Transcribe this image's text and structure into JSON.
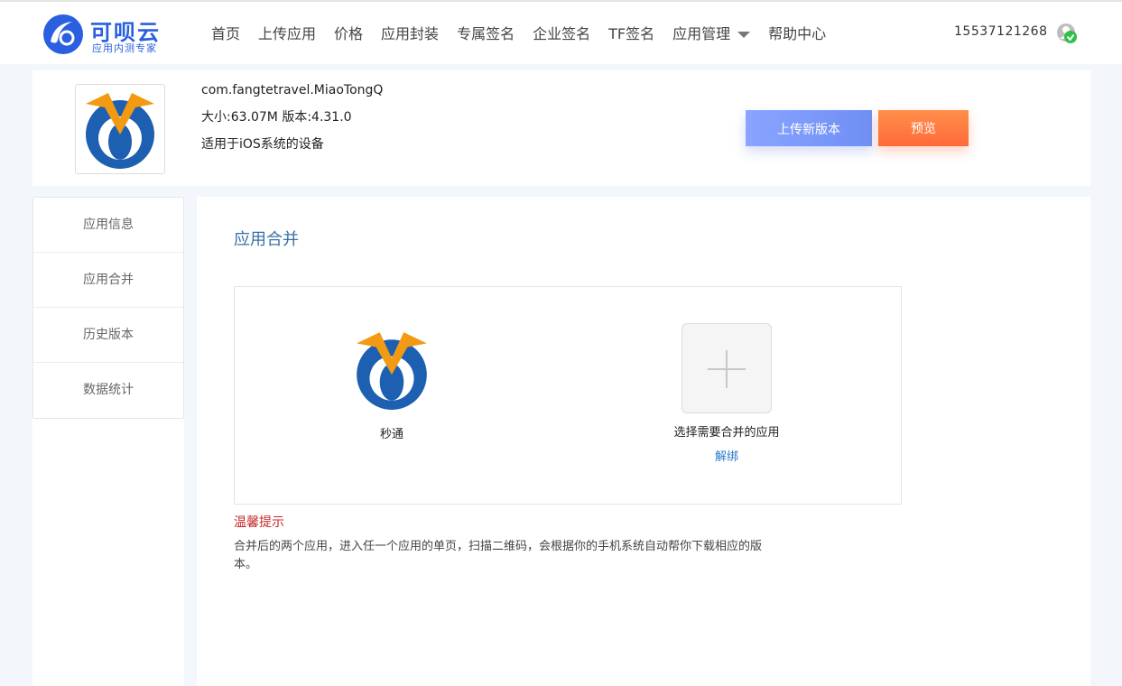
{
  "brand": {
    "name": "可呗云",
    "subtitle": "应用内测专家",
    "color": "#2a5fe0"
  },
  "nav": {
    "items": [
      "首页",
      "上传应用",
      "价格",
      "应用封装",
      "专属签名",
      "企业签名",
      "TF签名",
      "应用管理",
      "帮助中心"
    ],
    "dropdown_item": "应用管理"
  },
  "user": {
    "phone": "15537121268",
    "icon": "user-verified-icon"
  },
  "app": {
    "bundle_id": "com.fangtetravel.MiaoTongQ",
    "size_version": "大小:63.07M  版本:4.31.0",
    "platform": "适用于iOS系统的设备",
    "upload_label": "上传新版本",
    "preview_label": "预览"
  },
  "sidebar": {
    "items": [
      {
        "label": "应用信息"
      },
      {
        "label": "应用合并"
      },
      {
        "label": "历史版本"
      },
      {
        "label": "数据统计"
      }
    ]
  },
  "main": {
    "title": "应用合并",
    "current_app_name": "秒通",
    "add_label": "选择需要合并的应用",
    "unbind_label": "解绑",
    "tip_title": "温馨提示",
    "tip_text": "合并后的两个应用，进入任一个应用的单页，扫描二维码，会根据你的手机系统自动帮你下载相应的版本。"
  },
  "colors": {
    "accent_blue": "#2a7ac8",
    "title_blue": "#3a6fa8",
    "warning_red": "#c62828",
    "upload_btn": "#7f9aff",
    "preview_btn": "#ff7a40"
  }
}
